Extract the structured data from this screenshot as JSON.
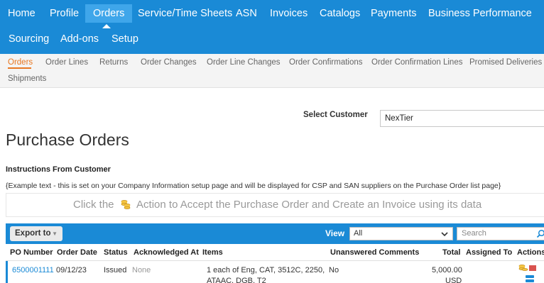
{
  "topnav": {
    "items": [
      "Home",
      "Profile",
      "Orders",
      "Service/Time Sheets",
      "ASN",
      "Invoices",
      "Catalogs",
      "Payments",
      "Business Performance",
      "Sourcing",
      "Add-ons",
      "Setup"
    ],
    "active": "Orders",
    "bg_color": "#1a8ad6"
  },
  "subnav": {
    "items": [
      "Orders",
      "Order Lines",
      "Returns",
      "Order Changes",
      "Order Line Changes",
      "Order Confirmations",
      "Order Confirmation Lines",
      "Promised Deliveries",
      "Shipments"
    ],
    "active": "Orders",
    "active_color": "#e87722"
  },
  "customer": {
    "label": "Select Customer",
    "value": "NexTier"
  },
  "page": {
    "title": "Purchase Orders",
    "instructions_title": "Instructions From Customer",
    "instructions_text": "{Example text - this is set on your Company Information setup page and will be displayed for CSP and SAN suppliers on the Purchase Order list page}",
    "banner_before": "Click the",
    "banner_after": "Action to Accept the Purchase Order and Create an Invoice using its data"
  },
  "toolbar": {
    "export_label": "Export to",
    "view_label": "View",
    "view_value": "All",
    "search_placeholder": "Search"
  },
  "table": {
    "columns": [
      "PO Number",
      "Order Date",
      "Status",
      "Acknowledged At",
      "Items",
      "Unanswered Comments",
      "Total",
      "Assigned To",
      "Actions"
    ],
    "rows": [
      {
        "po_number": "6500001111",
        "order_date": "09/12/23",
        "status": "Issued",
        "acknowledged_at": "None",
        "items_line1": "1 each of Eng, CAT, 3512C, 2250,",
        "items_line2": "ATAAC, DGB, T2",
        "unanswered_comments": "No",
        "total": "5,000.00",
        "currency": "USD"
      }
    ]
  }
}
